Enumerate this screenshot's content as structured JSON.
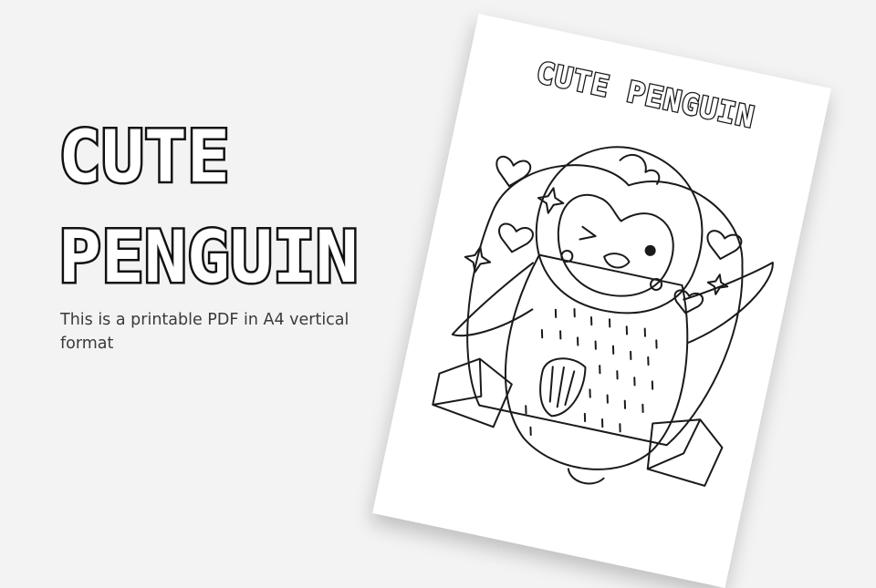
{
  "slide": {
    "title_line1": "CUTE",
    "title_line2": "PENGUIN",
    "subtitle": "This is a printable PDF in A4 vertical format"
  },
  "sheet": {
    "title": "CUTE PENGUIN"
  },
  "colors": {
    "background": "#f3f3f3",
    "ink": "#111111",
    "paper": "#ffffff"
  }
}
